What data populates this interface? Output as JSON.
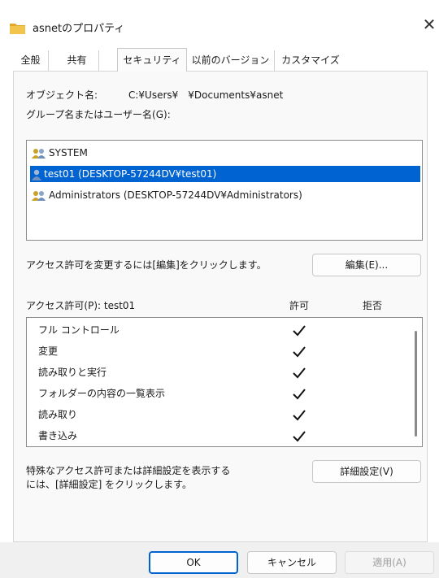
{
  "window": {
    "title": "asnetのプロパティ"
  },
  "tabs": [
    "全般",
    "共有",
    "セキュリティ",
    "以前のバージョン",
    "カスタマイズ"
  ],
  "selected_tab": "セキュリティ",
  "object": {
    "label": "オブジェクト名:",
    "path": "C:¥Users¥　¥Documents¥asnet"
  },
  "groups": {
    "label": "グループ名またはユーザー名(G):",
    "items": [
      {
        "name": "SYSTEM",
        "icon": "group-users-icon"
      },
      {
        "name": "test01 (DESKTOP-57244DV¥test01)",
        "icon": "user-icon",
        "selected": true
      },
      {
        "name": "Administrators (DESKTOP-57244DV¥Administrators)",
        "icon": "group-users-icon"
      }
    ]
  },
  "edit": {
    "hint": "アクセス許可を変更するには[編集]をクリックします。",
    "button": "編集(E)..."
  },
  "permissions": {
    "label": "アクセス許可(P): test01",
    "allow_header": "許可",
    "deny_header": "拒否",
    "rows": [
      {
        "name": "フル コントロール",
        "allow": true,
        "deny": false
      },
      {
        "name": "変更",
        "allow": true,
        "deny": false
      },
      {
        "name": "読み取りと実行",
        "allow": true,
        "deny": false
      },
      {
        "name": "フォルダーの内容の一覧表示",
        "allow": true,
        "deny": false
      },
      {
        "name": "読み取り",
        "allow": true,
        "deny": false
      },
      {
        "name": "書き込み",
        "allow": true,
        "deny": false
      }
    ]
  },
  "advanced": {
    "hint_line1": "特殊なアクセス許可または詳細設定を表示する",
    "hint_line2": "には、[詳細設定] をクリックします。",
    "button": "詳細設定(V)"
  },
  "footer": {
    "ok": "OK",
    "cancel": "キャンセル",
    "apply": "適用(A)"
  },
  "colors": {
    "selection": "#0063d2",
    "accent_border": "#0063d2",
    "folder": "#f3c44c"
  }
}
